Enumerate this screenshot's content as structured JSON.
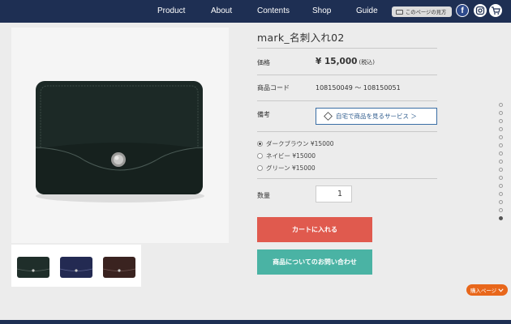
{
  "nav": {
    "items": [
      {
        "label": "Product"
      },
      {
        "label": "About"
      },
      {
        "label": "Contents"
      },
      {
        "label": "Shop"
      },
      {
        "label": "Guide"
      }
    ],
    "guide_pill": "このページの見方",
    "facebook_glyph": "f",
    "icons": [
      "monitor-icon",
      "facebook-icon",
      "instagram-icon",
      "cart-icon"
    ]
  },
  "product": {
    "title": "mark_名刺入れ02",
    "price_label": "価格",
    "price_value": "¥ 15,000",
    "price_tax": "(税込)",
    "code_label": "商品コード",
    "code_value": "108150049 ～ 108150051",
    "note_label": "備考",
    "service_button": "自宅で商品を見るサービス ＞",
    "options": [
      {
        "label": "ダークブラウン ¥15000",
        "selected": true
      },
      {
        "label": "ネイビー ¥15000",
        "selected": false
      },
      {
        "label": "グリーン ¥15000",
        "selected": false
      }
    ],
    "qty_label": "数量",
    "qty_value": "1",
    "cart_button": "カートに入れる",
    "inquiry_button": "商品についてのお問い合わせ",
    "thumbnail_colors": [
      "#1f2e2a",
      "#232a52",
      "#3a2320"
    ],
    "main_color": "#1f2d28"
  },
  "side": {
    "page_tab": "購入ページ",
    "dot_count": 15,
    "active_dot": 14
  },
  "colors": {
    "header": "#1e2f53",
    "cart_button": "#e05a4e",
    "inquiry_button": "#4ab3a4",
    "page_tab": "#e8671b"
  }
}
